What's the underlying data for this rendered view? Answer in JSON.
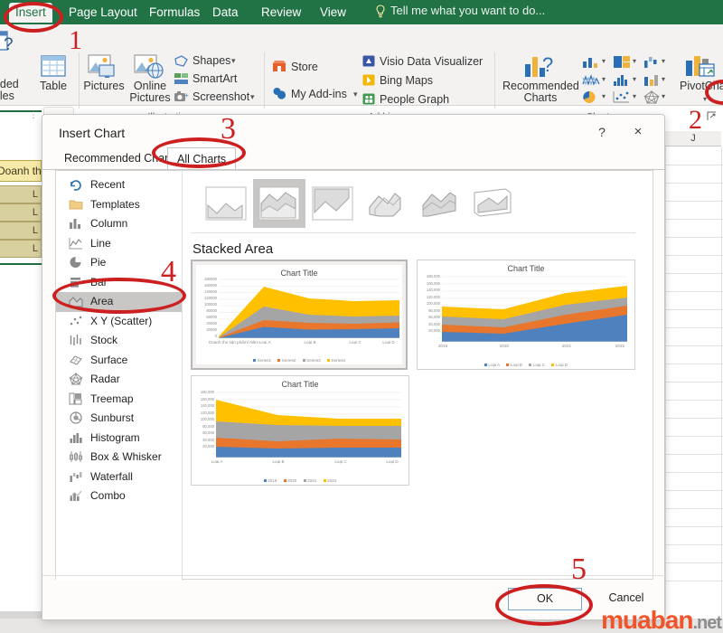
{
  "ribbon": {
    "tabs": [
      {
        "label": "Insert",
        "active": true
      },
      {
        "label": "Page Layout",
        "active": false
      },
      {
        "label": "Formulas",
        "active": false
      },
      {
        "label": "Data",
        "active": false
      },
      {
        "label": "Review",
        "active": false
      },
      {
        "label": "View",
        "active": false
      }
    ],
    "tell_me": "Tell me what you want to do...",
    "groups": [
      {
        "label": "Illustrations"
      },
      {
        "label": "Add-ins"
      },
      {
        "label": "Charts"
      }
    ],
    "tables_group": {
      "recommended_pivottables": "ended\nables",
      "table": "Table"
    },
    "illustrations": {
      "pictures": "Pictures",
      "online_pictures": "Online\nPictures",
      "shapes": "Shapes",
      "smartart": "SmartArt",
      "screenshot": "Screenshot"
    },
    "addins": {
      "store": "Store",
      "my_addins": "My Add-ins",
      "visio": "Visio Data Visualizer",
      "bing_maps": "Bing Maps",
      "people_graph": "People Graph"
    },
    "charts_group": {
      "recommended_charts": "Recommended\nCharts",
      "pivotchart": "PivotChart"
    }
  },
  "sheet": {
    "column_header": "J",
    "cells": [
      {
        "text": "Doanh th"
      },
      {
        "text": "L"
      },
      {
        "text": "L"
      },
      {
        "text": "L"
      },
      {
        "text": "L"
      }
    ]
  },
  "dialog": {
    "title": "Insert Chart",
    "help_icon": "?",
    "close_icon": "×",
    "tabs": [
      {
        "label": "Recommended Charts",
        "selected": false
      },
      {
        "label": "All Charts",
        "selected": true
      }
    ],
    "sidebar": [
      {
        "label": "Recent",
        "icon": "recent-icon",
        "selected": false
      },
      {
        "label": "Templates",
        "icon": "folder-icon",
        "selected": false
      },
      {
        "label": "Column",
        "icon": "column-chart-icon",
        "selected": false
      },
      {
        "label": "Line",
        "icon": "line-chart-icon",
        "selected": false
      },
      {
        "label": "Pie",
        "icon": "pie-chart-icon",
        "selected": false
      },
      {
        "label": "Bar",
        "icon": "bar-chart-icon",
        "selected": false
      },
      {
        "label": "Area",
        "icon": "area-chart-icon",
        "selected": true
      },
      {
        "label": "X Y (Scatter)",
        "icon": "scatter-chart-icon",
        "selected": false
      },
      {
        "label": "Stock",
        "icon": "stock-chart-icon",
        "selected": false
      },
      {
        "label": "Surface",
        "icon": "surface-chart-icon",
        "selected": false
      },
      {
        "label": "Radar",
        "icon": "radar-chart-icon",
        "selected": false
      },
      {
        "label": "Treemap",
        "icon": "treemap-chart-icon",
        "selected": false
      },
      {
        "label": "Sunburst",
        "icon": "sunburst-chart-icon",
        "selected": false
      },
      {
        "label": "Histogram",
        "icon": "histogram-chart-icon",
        "selected": false
      },
      {
        "label": "Box & Whisker",
        "icon": "boxwhisker-chart-icon",
        "selected": false
      },
      {
        "label": "Waterfall",
        "icon": "waterfall-chart-icon",
        "selected": false
      },
      {
        "label": "Combo",
        "icon": "combo-chart-icon",
        "selected": false
      }
    ],
    "chart_variants": [
      {
        "name": "area-icon",
        "selected": false
      },
      {
        "name": "stacked-area-icon",
        "selected": true
      },
      {
        "name": "100-stacked-area-icon",
        "selected": false
      },
      {
        "name": "3d-area-icon",
        "selected": false
      },
      {
        "name": "3d-stacked-area-icon",
        "selected": false
      },
      {
        "name": "3d-100-stacked-area-icon",
        "selected": false
      }
    ],
    "selected_type_name": "Stacked Area",
    "buttons": {
      "ok": "OK",
      "cancel": "Cancel"
    }
  },
  "annotations": [
    {
      "number": "1"
    },
    {
      "number": "2"
    },
    {
      "number": "3"
    },
    {
      "number": "4"
    },
    {
      "number": "5"
    }
  ],
  "watermark": {
    "main": "muaban",
    "suffix": ".net"
  },
  "chart_data": [
    {
      "id": "preview-1",
      "type": "area",
      "title": "Chart Title",
      "categories": [
        "Doanh thu sản phẩm/ Năm",
        "Loại A",
        "Loại B",
        "Loại C",
        "Loại D"
      ],
      "series": [
        {
          "name": "Series1",
          "color": "#4e81bd",
          "values": [
            2000,
            28000,
            26000,
            27000,
            29000
          ]
        },
        {
          "name": "Series2",
          "color": "#e8762c",
          "values": [
            1500,
            20000,
            14000,
            15000,
            16000
          ]
        },
        {
          "name": "Series3",
          "color": "#a5a5a5",
          "values": [
            1500,
            42000,
            26000,
            22000,
            20000
          ]
        },
        {
          "name": "Series4",
          "color": "#ffc000",
          "values": [
            2000,
            60000,
            48000,
            45000,
            45000
          ]
        }
      ],
      "ylim": [
        0,
        180000
      ],
      "ytick_labels": [
        "180000",
        "160000",
        "140000",
        "120000",
        "100000",
        "80000",
        "60000",
        "40000",
        "20000",
        "0"
      ],
      "legend_position": "bottom",
      "grid": true
    },
    {
      "id": "preview-2",
      "type": "area",
      "title": "Chart Title",
      "categories": [
        "2019",
        "2020",
        "2021",
        "2022"
      ],
      "series": [
        {
          "name": "Loại A",
          "color": "#4e81bd",
          "values": [
            28000,
            30000,
            44000,
            55000
          ]
        },
        {
          "name": "Loại B",
          "color": "#e8762c",
          "values": [
            20000,
            18000,
            28000,
            35000
          ]
        },
        {
          "name": "Loại C",
          "color": "#a5a5a5",
          "values": [
            22000,
            22000,
            22000,
            22000
          ]
        },
        {
          "name": "Loại D",
          "color": "#ffc000",
          "values": [
            26000,
            22000,
            28000,
            30000
          ]
        }
      ],
      "ylim": [
        0,
        180000
      ],
      "ytick_labels": [
        "180,000",
        "160,000",
        "140,000",
        "120,000",
        "100,000",
        "80,000",
        "60,000",
        "40,000",
        "20,000",
        "-"
      ],
      "legend_position": "bottom",
      "grid": true
    },
    {
      "id": "preview-3",
      "type": "area",
      "title": "Chart Title",
      "categories": [
        "Loại A",
        "Loại B",
        "Loại C",
        "Loại D"
      ],
      "series": [
        {
          "name": "2019",
          "color": "#4e81bd",
          "values": [
            25000,
            23000,
            23000,
            23000
          ]
        },
        {
          "name": "2020",
          "color": "#e8762c",
          "values": [
            22000,
            20000,
            25000,
            24000
          ]
        },
        {
          "name": "2021",
          "color": "#a5a5a5",
          "values": [
            45000,
            40000,
            36000,
            35000
          ]
        },
        {
          "name": "2022",
          "color": "#ffc000",
          "values": [
            60000,
            35000,
            32000,
            32000
          ]
        }
      ],
      "ylim": [
        0,
        180000
      ],
      "ytick_labels": [
        "180,000",
        "160,000",
        "140,000",
        "120,000",
        "100,000",
        "80,000",
        "60,000",
        "40,000",
        "20,000",
        "-"
      ],
      "legend_position": "bottom",
      "grid": true
    }
  ]
}
